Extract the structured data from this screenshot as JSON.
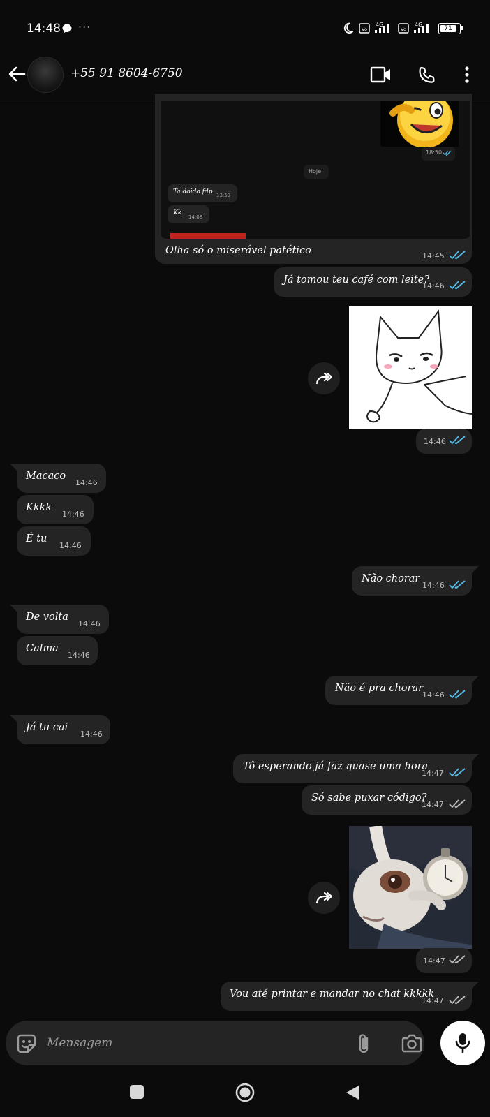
{
  "status_bar": {
    "time": "14:48",
    "dots": "···",
    "battery": "71"
  },
  "header": {
    "contact": "+55 91 8604-6750"
  },
  "quoted_screenshot": {
    "inner_time_top": "18:50",
    "day_label": "Hoje",
    "inner_msg1": "Tá doido fdp",
    "inner_msg1_time": "13:59",
    "inner_msg2": "Kk",
    "inner_msg2_time": "14:08"
  },
  "messages": [
    {
      "text": "Olha só o miserável patético",
      "time": "14:45"
    },
    {
      "text": "Já tomou teu café com leite?",
      "time": "14:46"
    },
    {
      "text": "",
      "time": "14:46"
    },
    {
      "text": "Macaco",
      "time": "14:46"
    },
    {
      "text": "Kkkk",
      "time": "14:46"
    },
    {
      "text": "É tu",
      "time": "14:46"
    },
    {
      "text": "Não chorar",
      "time": "14:46"
    },
    {
      "text": "De volta",
      "time": "14:46"
    },
    {
      "text": "Calma",
      "time": "14:46"
    },
    {
      "text": "Não é pra chorar",
      "time": "14:46"
    },
    {
      "text": "Já tu cai",
      "time": "14:46"
    },
    {
      "text": "Tô esperando já faz quase uma hora",
      "time": "14:47"
    },
    {
      "text": "Só sabe puxar código?",
      "time": "14:47"
    },
    {
      "text": "",
      "time": "14:47"
    },
    {
      "text": "Vou até printar e mandar no chat kkkkk",
      "time": "14:47"
    }
  ],
  "composer": {
    "placeholder": "Mensagem"
  },
  "colors": {
    "background": "#0b0b0b",
    "bubble": "#242424",
    "read_tick": "#53bdeb",
    "sent_tick": "#bdbdbd"
  }
}
